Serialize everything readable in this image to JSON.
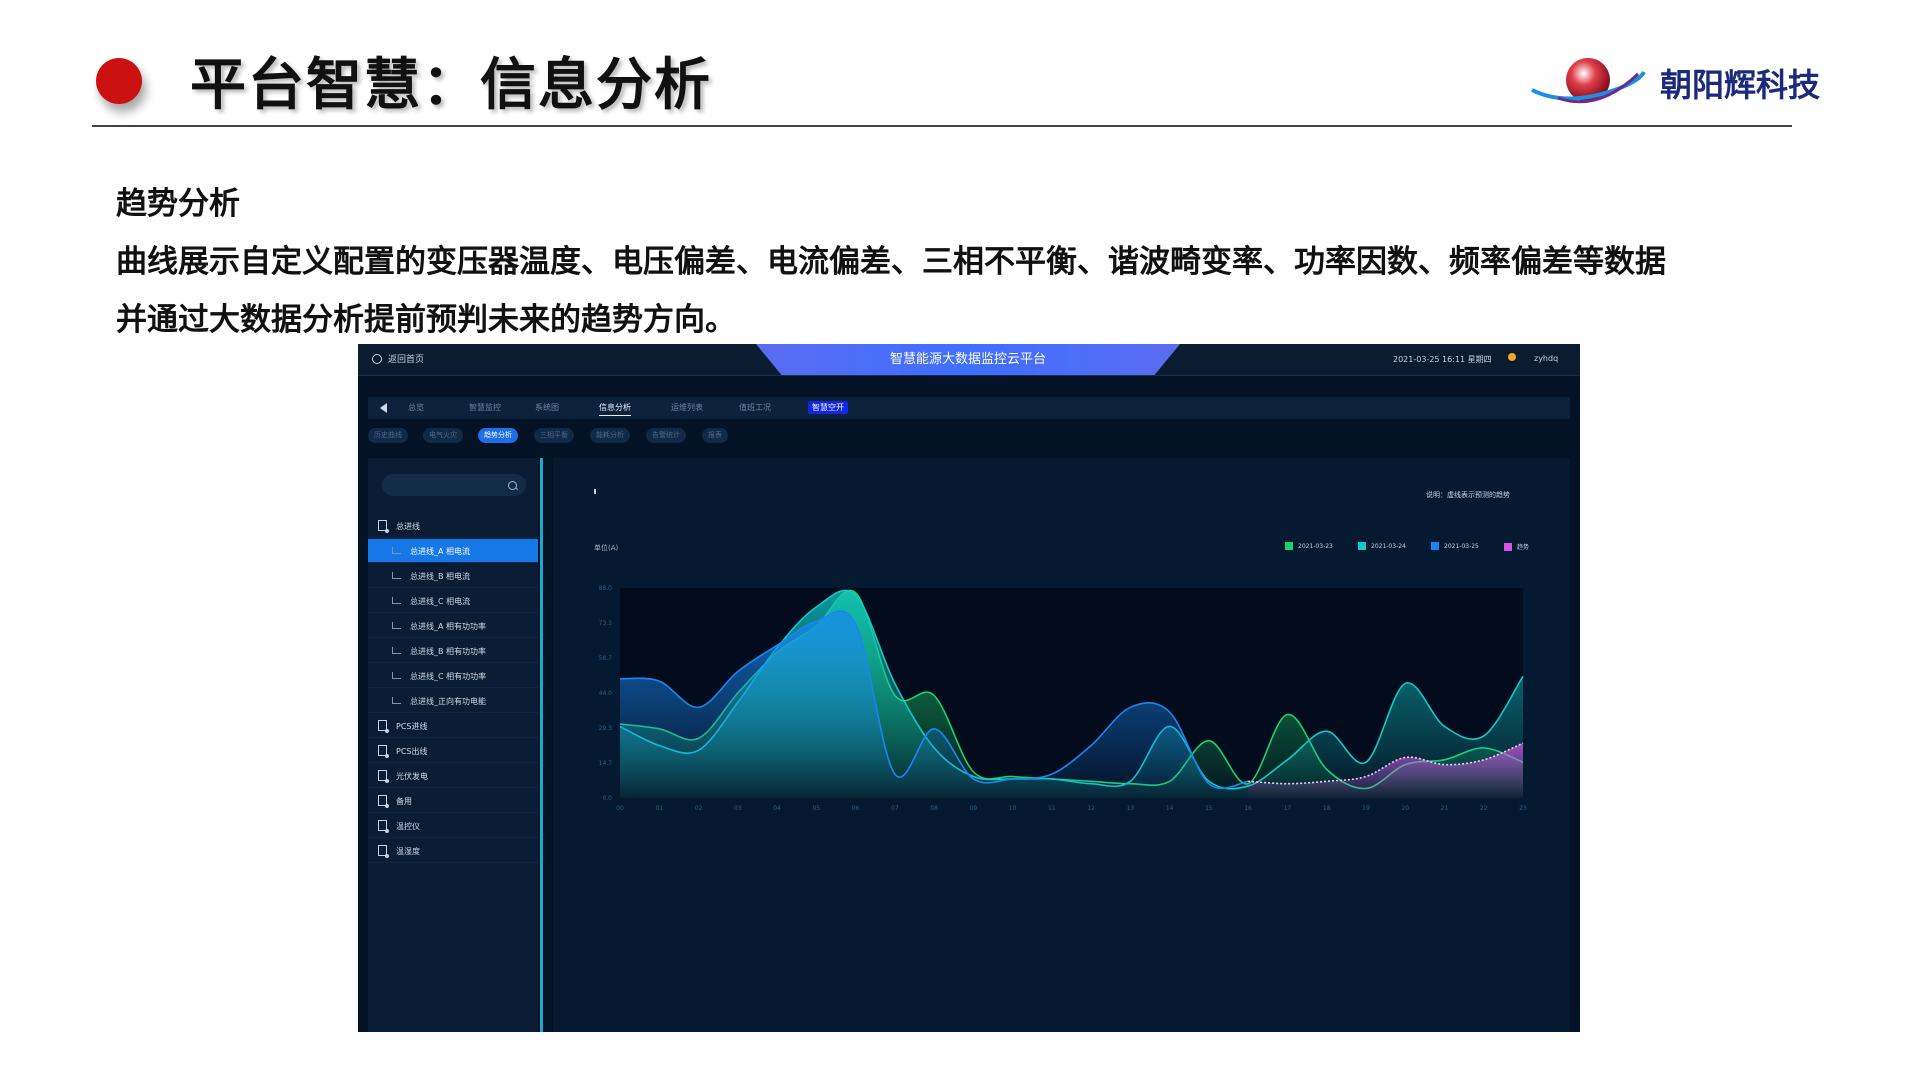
{
  "slide": {
    "title": "平台智慧：信息分析",
    "brand": "朝阳辉科技",
    "section_title": "趋势分析",
    "desc_line1": "曲线展示自定义配置的变压器温度、电压偏差、电流偏差、三相不平衡、谐波畸变率、功率因数、频率偏差等数据",
    "desc_line2": "并通过大数据分析提前预判未来的趋势方向。"
  },
  "app": {
    "back_label": "返回首页",
    "platform_title": "智慧能源大数据监控云平台",
    "datetime": "2021-03-25 16:11 星期四",
    "user": "zyhdq",
    "nav": [
      {
        "label": "总览"
      },
      {
        "label": "智慧监控"
      },
      {
        "label": "系统图"
      },
      {
        "label": "信息分析"
      },
      {
        "label": "运维列表"
      },
      {
        "label": "值班工况"
      },
      {
        "label": "智慧空开"
      }
    ],
    "subtabs": [
      {
        "label": "历史曲线"
      },
      {
        "label": "电气火灾"
      },
      {
        "label": "趋势分析"
      },
      {
        "label": "三相平衡"
      },
      {
        "label": "能耗分析"
      },
      {
        "label": "告警统计"
      },
      {
        "label": "报表"
      }
    ],
    "tree": [
      {
        "label": "总进线"
      },
      {
        "label": "总进线_A 相电流"
      },
      {
        "label": "总进线_B 相电流"
      },
      {
        "label": "总进线_C 相电流"
      },
      {
        "label": "总进线_A 相有功功率"
      },
      {
        "label": "总进线_B 相有功功率"
      },
      {
        "label": "总进线_C 相有功功率"
      },
      {
        "label": "总进线_正向有功电能"
      },
      {
        "label": "PCS进线"
      },
      {
        "label": "PCS出线"
      },
      {
        "label": "光伏发电"
      },
      {
        "label": "备用"
      },
      {
        "label": "温控仪"
      },
      {
        "label": "温湿度"
      }
    ]
  },
  "chart_data": {
    "type": "area",
    "note": "说明：虚线表示预测的趋势",
    "ylabel": "单位(A)",
    "y_ticks": [
      "0.0",
      "14.7",
      "29.3",
      "44.0",
      "58.7",
      "73.3",
      "88.0"
    ],
    "ylim": [
      0,
      88
    ],
    "categories": [
      "00",
      "01",
      "02",
      "03",
      "04",
      "05",
      "06",
      "07",
      "08",
      "09",
      "10",
      "11",
      "12",
      "13",
      "14",
      "15",
      "16",
      "17",
      "18",
      "19",
      "20",
      "21",
      "22",
      "23"
    ],
    "grid": false,
    "legend_position": "top-right",
    "series": [
      {
        "name": "2021-03-23",
        "color": "#19d26a",
        "values": [
          31,
          29,
          25,
          44,
          61,
          72,
          86,
          43,
          43,
          11,
          9,
          8,
          7,
          6,
          7,
          24,
          6,
          35,
          12,
          4,
          14,
          16,
          21,
          15
        ]
      },
      {
        "name": "2021-03-24",
        "color": "#11c9c9",
        "values": [
          30,
          22,
          20,
          40,
          63,
          80,
          85,
          48,
          21,
          9,
          8,
          8,
          6,
          7,
          30,
          7,
          5,
          16,
          28,
          15,
          48,
          30,
          26,
          51
        ]
      },
      {
        "name": "2021-03-25",
        "color": "#1a86f2",
        "values": [
          50,
          49,
          38,
          53,
          64,
          74,
          73,
          10,
          29,
          8,
          8,
          10,
          22,
          38,
          36,
          6,
          7,
          null,
          null,
          null,
          null,
          null,
          null,
          null
        ]
      },
      {
        "name": "趋势",
        "color": "#d257e6",
        "values": [
          null,
          null,
          null,
          null,
          null,
          null,
          null,
          null,
          null,
          null,
          null,
          null,
          null,
          null,
          null,
          null,
          7,
          6,
          7,
          9,
          17,
          14,
          16,
          23
        ]
      }
    ]
  }
}
